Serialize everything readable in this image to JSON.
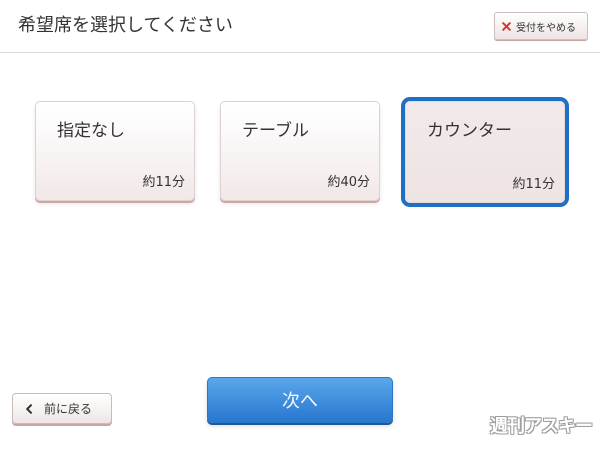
{
  "header": {
    "title": "希望席を選択してください",
    "cancel_button": {
      "icon": "close-icon",
      "label": "受付をやめる"
    }
  },
  "seat_options": [
    {
      "label": "指定なし",
      "wait": "約11分",
      "selected": false
    },
    {
      "label": "テーブル",
      "wait": "約40分",
      "selected": false
    },
    {
      "label": "カウンター",
      "wait": "約11分",
      "selected": true
    }
  ],
  "footer": {
    "back_button": {
      "icon": "chevron-left-icon",
      "label": "前に戻る"
    },
    "next_button": {
      "label": "次へ"
    }
  },
  "watermark": "週刊アスキー",
  "colors": {
    "selection_border": "#1f6fc5",
    "next_button_top": "#5aa7ea",
    "next_button_bottom": "#2777d0",
    "close_icon": "#d8342c"
  }
}
